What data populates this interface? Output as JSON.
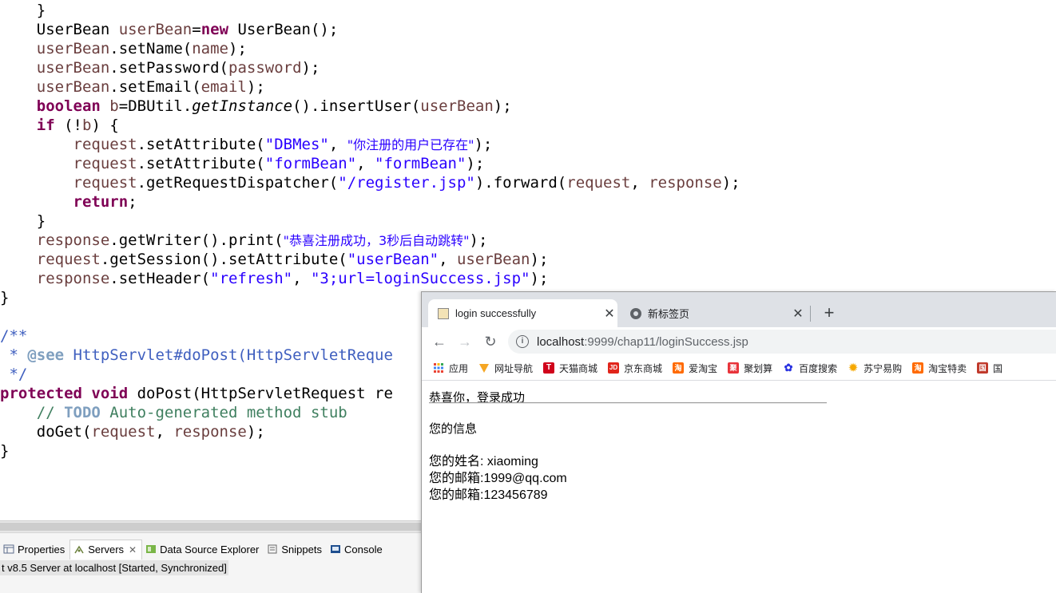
{
  "editor": {
    "lines": [
      [
        "    }"
      ],
      [
        "    UserBean userBean=new UserBean();"
      ],
      [
        "    userBean.setName(name);"
      ],
      [
        "    userBean.setPassword(password);"
      ],
      [
        "    userBean.setEmail(email);"
      ],
      [
        "    boolean b=DBUtil.getInstance().insertUser(userBean);"
      ],
      [
        "    if (!b) {"
      ],
      [
        "        request.setAttribute(\"DBMes\", \"你注册的用户已存在\");"
      ],
      [
        "        request.setAttribute(\"formBean\", \"formBean\");"
      ],
      [
        "        request.getRequestDispatcher(\"/register.jsp\").forward(request, response);"
      ],
      [
        "        return;"
      ],
      [
        "    }"
      ],
      [
        "    response.getWriter().print(\"恭喜注册成功，3秒后自动跳转\");"
      ],
      [
        "    request.getSession().setAttribute(\"userBean\", userBean);"
      ],
      [
        "    response.setHeader(\"refresh\", \"3;url=loginSuccess.jsp\");"
      ],
      [
        "}"
      ],
      [
        ""
      ],
      [
        "/**"
      ],
      [
        " * @see HttpServlet#doPost(HttpServletReque"
      ],
      [
        " */"
      ],
      [
        "protected void doPost(HttpServletRequest re"
      ],
      [
        "    // TODO Auto-generated method stub"
      ],
      [
        "    doGet(request, response);"
      ],
      [
        "}"
      ]
    ]
  },
  "views": {
    "tabs": [
      {
        "label": "Properties",
        "icon": "properties-icon"
      },
      {
        "label": "Servers",
        "icon": "servers-icon",
        "active": true
      },
      {
        "label": "Data Source Explorer",
        "icon": "data-source-icon"
      },
      {
        "label": "Snippets",
        "icon": "snippets-icon"
      },
      {
        "label": "Console",
        "icon": "console-icon"
      }
    ],
    "server_line": "t v8.5 Server at localhost  [Started, Synchronized]"
  },
  "browser": {
    "tabs": [
      {
        "title": "login successfully",
        "close": "✕"
      },
      {
        "title": "新标签页",
        "close": "✕"
      }
    ],
    "new_tab": "+",
    "nav": {
      "back": "←",
      "forward": "→",
      "reload": "↻"
    },
    "url": {
      "host": "localhost",
      "rest": ":9999/chap11/loginSuccess.jsp"
    },
    "bookmarks": [
      {
        "label": "应用",
        "icon": "apps-icon",
        "color": "#ffffff"
      },
      {
        "label": "网址导航",
        "icon": "nav-site-icon",
        "color": "#f5a623"
      },
      {
        "label": "天猫商城",
        "icon": "tmall-icon",
        "color": "#d0021b",
        "glyph": "T"
      },
      {
        "label": "京东商城",
        "icon": "jd-icon",
        "color": "#e1251b",
        "glyph": "JD"
      },
      {
        "label": "爱淘宝",
        "icon": "aitaobao-icon",
        "color": "#ff6a00",
        "glyph": "淘"
      },
      {
        "label": "聚划算",
        "icon": "juhuasuan-icon",
        "color": "#e8333a",
        "glyph": "聚"
      },
      {
        "label": "百度搜索",
        "icon": "baidu-icon",
        "color": "#2932e1",
        "glyph": "✿"
      },
      {
        "label": "苏宁易购",
        "icon": "suning-icon",
        "color": "#f6a800",
        "glyph": "✹"
      },
      {
        "label": "淘宝特卖",
        "icon": "taobao-sale-icon",
        "color": "#ff6a00",
        "glyph": "淘"
      },
      {
        "label": "国",
        "icon": "guo-icon",
        "color": "#c0392b",
        "glyph": "国"
      }
    ],
    "page": {
      "greeting": "恭喜你，登录成功",
      "info_heading": "您的信息",
      "name_line": "您的姓名: xiaoming",
      "email_line": "您的邮箱:1999@qq.com",
      "password_line": "您的邮箱:123456789"
    }
  }
}
